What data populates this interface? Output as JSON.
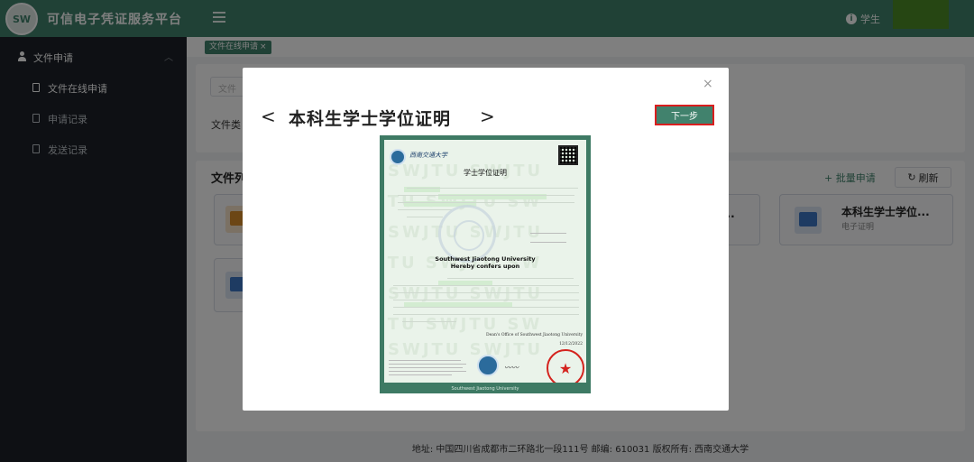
{
  "header": {
    "app_title": "可信电子凭证服务平台",
    "user_label": "学生",
    "accent_color": "#41826d"
  },
  "sidebar": {
    "group": {
      "label": "文件申请",
      "icon": "person-icon"
    },
    "items": [
      {
        "label": "文件在线申请",
        "active": true,
        "icon": "document-icon"
      },
      {
        "label": "申请记录",
        "active": false,
        "icon": "document-icon"
      },
      {
        "label": "发送记录",
        "active": false,
        "icon": "document-icon"
      }
    ]
  },
  "tabs": [
    {
      "label": "文件在线申请",
      "close": "×"
    }
  ],
  "filter": {
    "placeholder": "文件",
    "type_label": "文件类"
  },
  "file_list": {
    "title": "文件列",
    "batch_button": "+ 批量申请",
    "refresh_button": "刷新",
    "cards": [
      {
        "title": "本科生学士学位...",
        "subtitle": "电子证明"
      },
      {
        "title": "...",
        "subtitle": ""
      }
    ]
  },
  "modal": {
    "title": "本科生学士学位证明",
    "prev": "<",
    "next": ">",
    "next_step_button": "下一步",
    "close": "×",
    "certificate": {
      "school_name": "西南交通大学",
      "heading": "学士学位证明",
      "en_title_1": "Southwest Jiaotong University",
      "en_title_2": "Hereby confers upon",
      "en_signature": "Dean's Office of Southwest Jiaotong University",
      "en_date": "12/12/2022",
      "bottom_caption": "Southwest Jiaotong University"
    }
  },
  "footer": {
    "text": "地址: 中国四川省成都市二环路北一段111号   邮编: 610031   版权所有: 西南交通大学"
  }
}
